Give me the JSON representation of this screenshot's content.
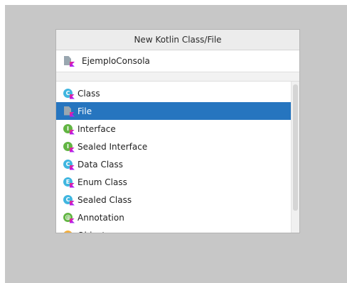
{
  "dialog": {
    "title": "New Kotlin Class/File",
    "name_field": {
      "value": "EjemploConsola",
      "icon": "kotlin-file-icon"
    }
  },
  "kinds": [
    {
      "label": "Class",
      "icon": "kotlin-class-icon",
      "letter": "C",
      "color": "#40b6e0",
      "selected": false
    },
    {
      "label": "File",
      "icon": "kotlin-file-icon",
      "letter": "",
      "color": "#9aa7b0",
      "selected": true
    },
    {
      "label": "Interface",
      "icon": "kotlin-interface-icon",
      "letter": "I",
      "color": "#62b543",
      "selected": false
    },
    {
      "label": "Sealed Interface",
      "icon": "kotlin-sealed-interface-icon",
      "letter": "I",
      "color": "#62b543",
      "selected": false
    },
    {
      "label": "Data Class",
      "icon": "kotlin-data-class-icon",
      "letter": "C",
      "color": "#40b6e0",
      "selected": false
    },
    {
      "label": "Enum Class",
      "icon": "kotlin-enum-class-icon",
      "letter": "E",
      "color": "#40b6e0",
      "selected": false
    },
    {
      "label": "Sealed Class",
      "icon": "kotlin-sealed-class-icon",
      "letter": "C",
      "color": "#40b6e0",
      "selected": false
    },
    {
      "label": "Annotation",
      "icon": "kotlin-annotation-icon",
      "letter": "@",
      "color": "#62b543",
      "selected": false
    },
    {
      "label": "Object",
      "icon": "kotlin-object-icon",
      "letter": "O",
      "color": "#f4af3d",
      "selected": false
    }
  ],
  "colors": {
    "selection": "#2675bf",
    "title_bar": "#ececec",
    "backdrop": "#c7c7c7"
  }
}
